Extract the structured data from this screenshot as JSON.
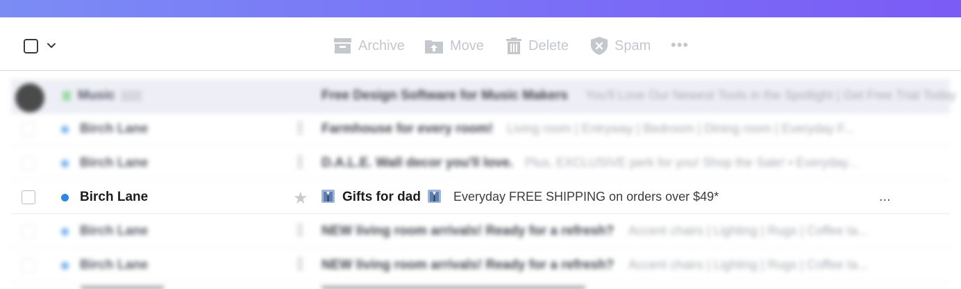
{
  "toolbar": {
    "archive_label": "Archive",
    "move_label": "Move",
    "delete_label": "Delete",
    "spam_label": "Spam",
    "more_label": "•••"
  },
  "rows": [
    {
      "sender": "Music",
      "subject": "Free Design Software for Music Makers",
      "preview": "You'll Love Our Newest Tools in the Spotlight | Get Free Trial Today",
      "blurred": true,
      "highlight": true
    },
    {
      "sender": "Birch Lane",
      "subject": "Farmhouse for every room!",
      "preview": "Living room | Entryway | Bedroom | Dining room | Everyday F...",
      "blurred": true
    },
    {
      "sender": "Birch Lane",
      "subject": "D.A.L.E. Wall decor you'll love.",
      "preview": "Plus, EXCLUSIVE perk for you! Shop the Sale! • Everyday...",
      "blurred": true
    },
    {
      "sender": "Birch Lane",
      "subject": "Gifts for dad",
      "preview": "Everyday FREE SHIPPING on orders over $49*",
      "more": "...",
      "blurred": false
    },
    {
      "sender": "Birch Lane",
      "subject": "NEW living room arrivals! Ready for a refresh?",
      "preview": "Accent chairs | Lighting | Rugs | Coffee ta...",
      "blurred": true
    },
    {
      "sender": "Birch Lane",
      "subject": "NEW living room arrivals! Ready for a refresh?",
      "preview": "Accent chairs | Lighting | Rugs | Coffee ta...",
      "blurred": true
    }
  ],
  "colors": {
    "accent_gradient_start": "#7b8cf5",
    "accent_gradient_end": "#7b5cf5",
    "unread_dot": "#2f86e0"
  },
  "icons": [
    "checkbox-icon",
    "chevron-down-icon",
    "archive-icon",
    "move-icon",
    "trash-icon",
    "spam-shield-icon",
    "more-icon",
    "star-icon",
    "gift-icon"
  ]
}
